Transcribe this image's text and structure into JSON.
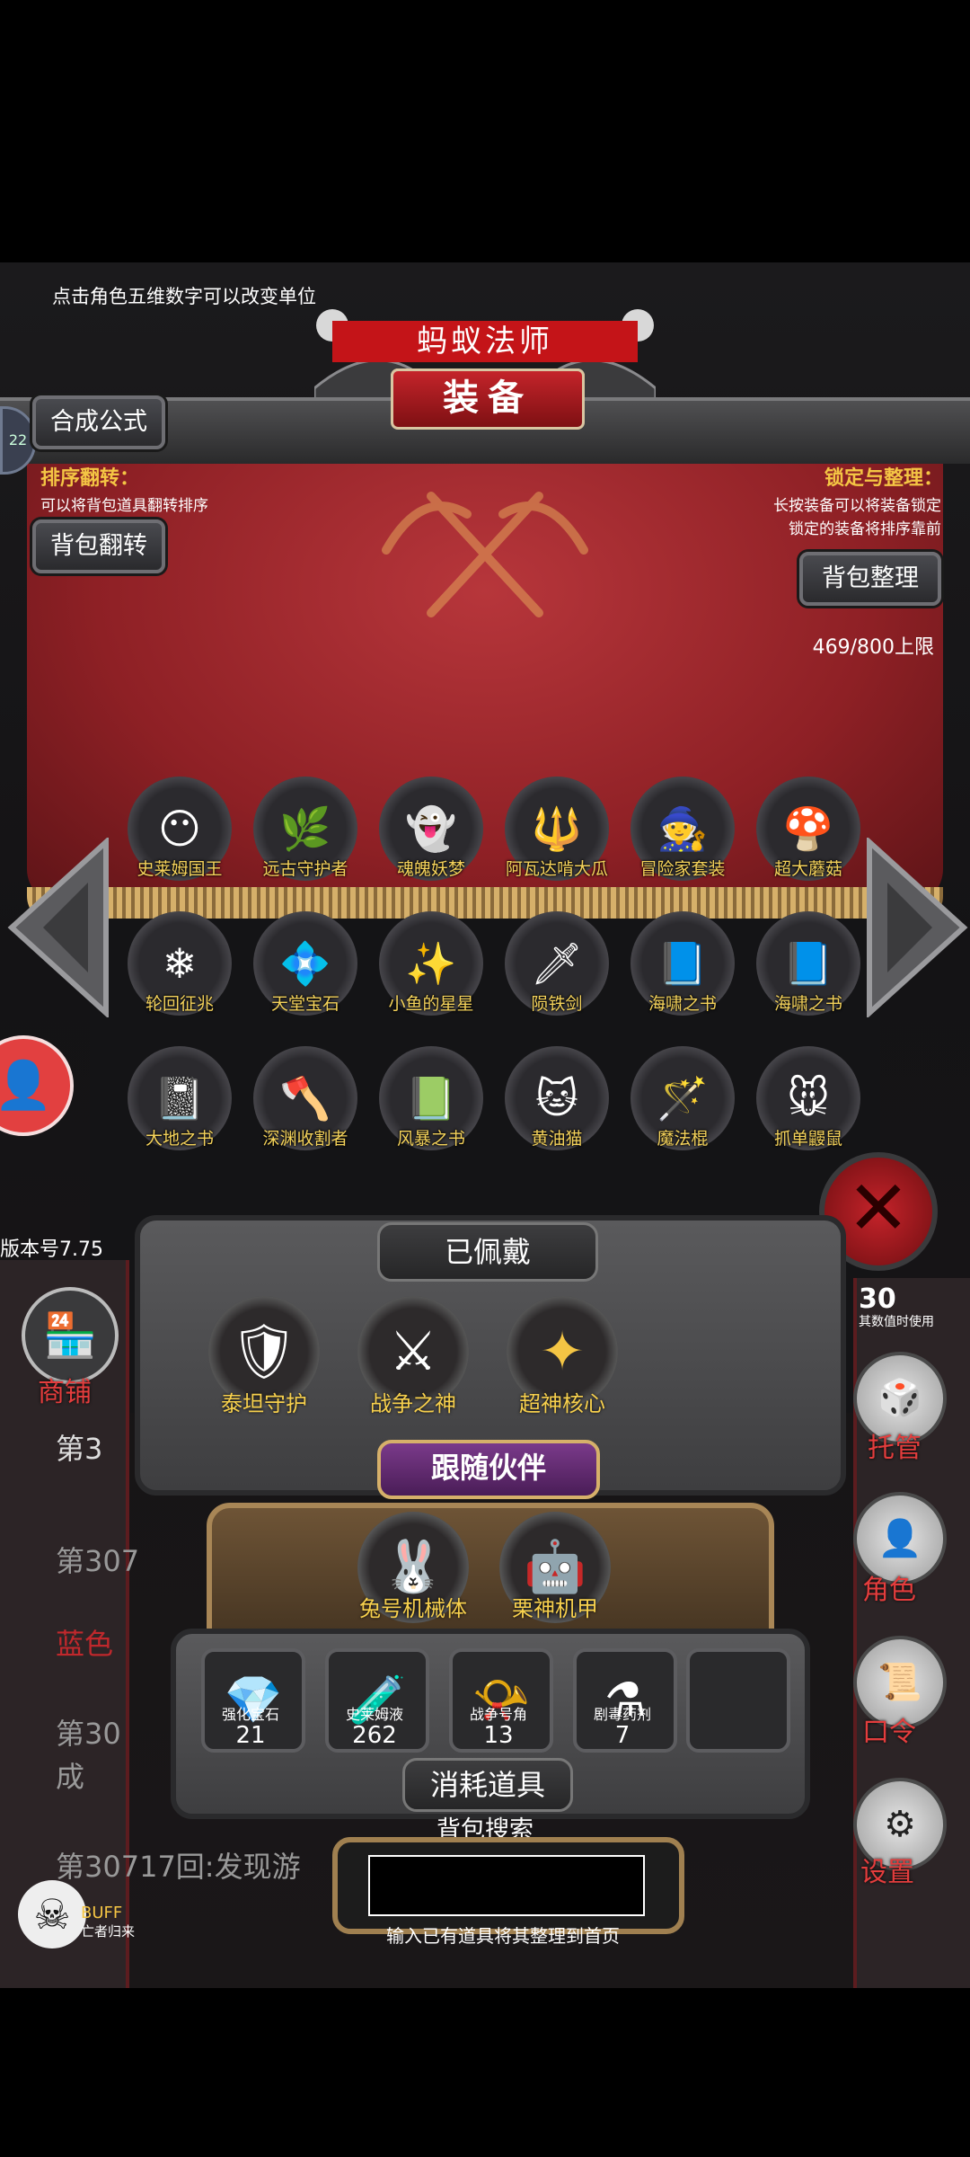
{
  "tip": "点击角色五维数字可以改变单位",
  "title": "蚂蚁法师",
  "panel_title": "装备",
  "buttons": {
    "synthesis": "合成公式",
    "sort_flip": "背包翻转",
    "bag_organize": "背包整理"
  },
  "info": {
    "sort_flip_title": "排序翻转：",
    "sort_flip_desc": "可以将背包道具翻转排序",
    "lock_title": "锁定与整理：",
    "lock_desc1": "长按装备可以将装备锁定",
    "lock_desc2": "锁定的装备将排序靠前"
  },
  "capacity": "469/800上限",
  "items": [
    {
      "name": "史莱姆国王",
      "icon": "slime-king-icon"
    },
    {
      "name": "远古守护者",
      "icon": "ancient-guardian-icon"
    },
    {
      "name": "魂魄妖梦",
      "icon": "youmu-icon"
    },
    {
      "name": "阿瓦达啃大瓜",
      "icon": "staff-icon"
    },
    {
      "name": "冒险家套装",
      "icon": "adventurer-set-icon"
    },
    {
      "name": "超大蘑菇",
      "icon": "mushroom-icon"
    },
    {
      "name": "轮回征兆",
      "icon": "ice-staff-icon"
    },
    {
      "name": "天堂宝石",
      "icon": "heaven-gem-icon"
    },
    {
      "name": "小鱼的星星",
      "icon": "star-icon"
    },
    {
      "name": "陨铁剑",
      "icon": "sword-icon"
    },
    {
      "name": "海啸之书",
      "icon": "book-icon"
    },
    {
      "name": "海啸之书",
      "icon": "book-icon"
    },
    {
      "name": "大地之书",
      "icon": "earth-book-icon"
    },
    {
      "name": "深渊收割者",
      "icon": "reaper-icon"
    },
    {
      "name": "风暴之书",
      "icon": "storm-book-icon"
    },
    {
      "name": "黄油猫",
      "icon": "butter-cat-icon"
    },
    {
      "name": "魔法棍",
      "icon": "magic-rod-icon"
    },
    {
      "name": "抓单鼹鼠",
      "icon": "mole-icon"
    }
  ],
  "equipped": {
    "title": "已佩戴",
    "items": [
      {
        "name": "泰坦守护"
      },
      {
        "name": "战争之神"
      },
      {
        "name": "超神核心"
      }
    ]
  },
  "companions": {
    "title": "跟随伙伴",
    "items": [
      {
        "name": "兔号机械体"
      },
      {
        "name": "栗神机甲"
      }
    ]
  },
  "consumables": {
    "title": "消耗道具",
    "items": [
      {
        "name": "强化宝石",
        "count": "21"
      },
      {
        "name": "史莱姆液",
        "count": "262"
      },
      {
        "name": "战争号角",
        "count": "13"
      },
      {
        "name": "剧毒药剂",
        "count": "7"
      }
    ]
  },
  "search": {
    "title": "背包搜索",
    "hint": "输入已有道具将其整理到首页",
    "value": ""
  },
  "version": "版本号7.75",
  "left_menu": {
    "shop": "商铺",
    "log_1": "第3",
    "log_2": "第307",
    "log_3": "蓝色",
    "log_4": "第30",
    "log_5": "成",
    "log_6": "第30717回:发现游",
    "buff": "BUFF",
    "buff_sub": "亡者归来"
  },
  "right_menu": {
    "stat_value": "30",
    "stat_hint": "其数值时使用",
    "auto": "托管",
    "role": "角色",
    "code": "口令",
    "settings": "设置"
  },
  "badge_left": "22",
  "colors": {
    "accent_red": "#c41418",
    "gold": "#f4c544",
    "stone": "#4a4a4c"
  }
}
